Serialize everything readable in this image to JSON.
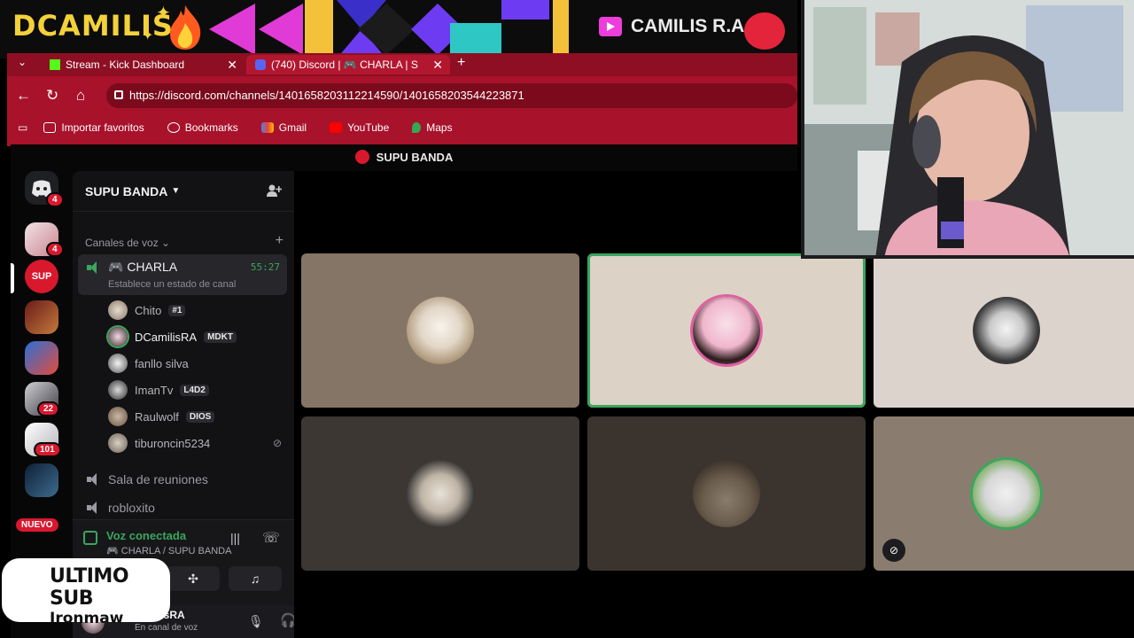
{
  "overlay": {
    "brand": "DCAMILIS",
    "channel_name": "CAMILIS R.A",
    "last_sub_title": "ULTIMO SUB",
    "last_sub_name": "Ironmaw"
  },
  "browser": {
    "tabs": [
      {
        "label": "Stream - Kick Dashboard",
        "icon": "kick-icon"
      },
      {
        "label": "(740) Discord | 🎮 CHARLA | S",
        "icon": "discord-icon"
      }
    ],
    "url": "https://discord.com/channels/1401658203112214590/1401658203544223871",
    "bookmarks": [
      "Importar favoritos",
      "Bookmarks",
      "Gmail",
      "YouTube",
      "Maps"
    ]
  },
  "discord": {
    "server_name": "SUPU BANDA",
    "guild_badges": [
      "4",
      "4",
      "22",
      "101"
    ],
    "nuevo_label": "NUEVO",
    "voice_section_title": "Canales de voz",
    "active_channel": {
      "name": "🎮 CHARLA",
      "timer": "55:27",
      "status_placeholder": "Establece un estado de canal"
    },
    "members": [
      {
        "name": "Chito",
        "tag": "#1"
      },
      {
        "name": "DCamilisRA",
        "tag": "MDKT"
      },
      {
        "name": "fanllo silva",
        "tag": ""
      },
      {
        "name": "ImanTv",
        "tag": "L4D2"
      },
      {
        "name": "Raulwolf",
        "tag": "DIOS"
      },
      {
        "name": "tiburoncin5234",
        "tag": ""
      }
    ],
    "other_channels": [
      "Sala de reuniones",
      "robloxito"
    ],
    "voice_connected": "Voz conectada",
    "voice_location": "🎮 CHARLA / SUPU BANDA",
    "user_name": "DCamilisRA",
    "user_status": "En canal de voz"
  },
  "colors": {
    "browser_red": "#a8122a",
    "speaking_green": "#3ba55d",
    "accent_yellow": "#f3d13a"
  }
}
